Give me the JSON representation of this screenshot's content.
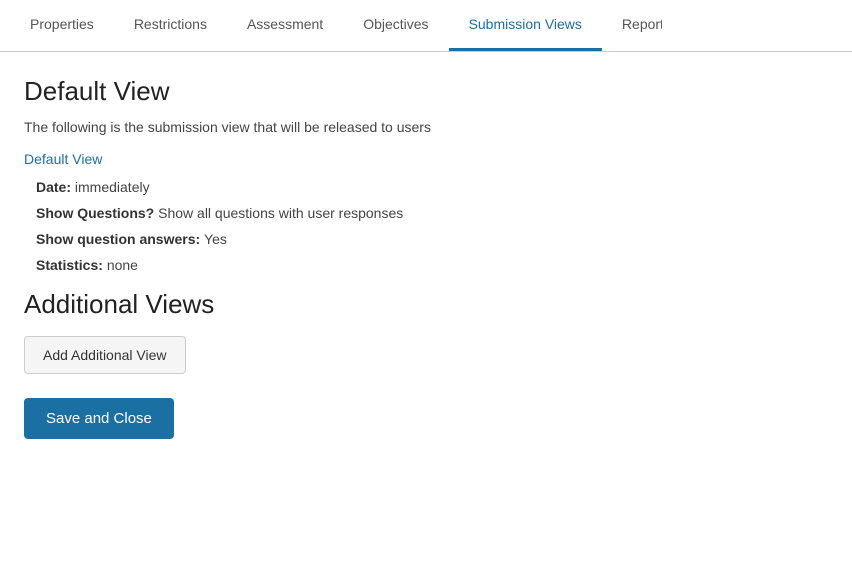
{
  "tabs": [
    {
      "id": "properties",
      "label": "Properties",
      "active": false
    },
    {
      "id": "restrictions",
      "label": "Restrictions",
      "active": false
    },
    {
      "id": "assessment",
      "label": "Assessment",
      "active": false
    },
    {
      "id": "objectives",
      "label": "Objectives",
      "active": false
    },
    {
      "id": "submission-views",
      "label": "Submission Views",
      "active": true
    },
    {
      "id": "reports",
      "label": "Reports",
      "active": false,
      "partial": true
    }
  ],
  "main": {
    "default_view_title": "Default View",
    "description": "The following is the submission view that will be released to users",
    "default_view_link": "Default View",
    "details": [
      {
        "label": "Date:",
        "value": "immediately"
      },
      {
        "label": "Show Questions?",
        "value": "Show all questions with user responses"
      },
      {
        "label": "Show question answers:",
        "value": "Yes"
      },
      {
        "label": "Statistics:",
        "value": "none"
      }
    ],
    "additional_views_title": "Additional Views",
    "add_additional_label": "Add Additional View",
    "save_close_label": "Save and Close"
  }
}
